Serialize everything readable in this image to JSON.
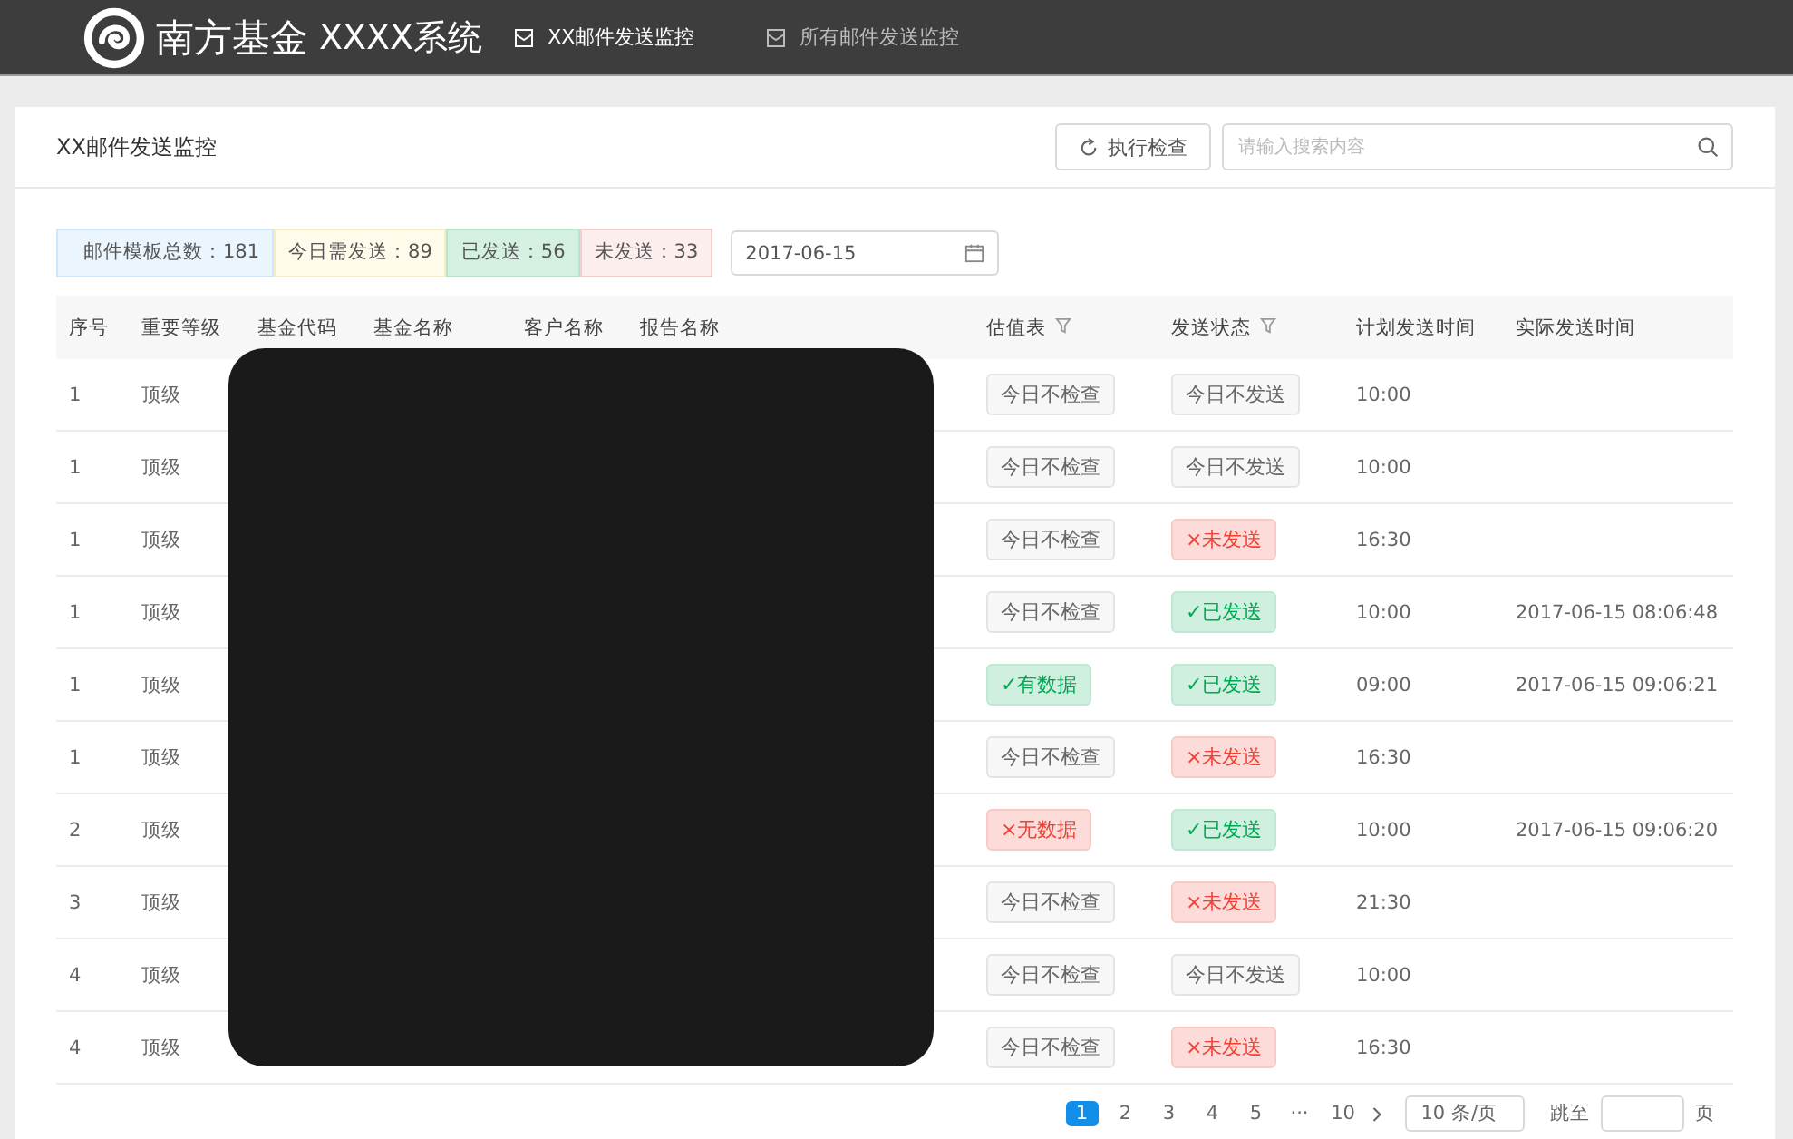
{
  "header": {
    "brand": "南方基金",
    "system": "XXXX系统",
    "nav": [
      {
        "label": "XX邮件发送监控",
        "selected": true
      },
      {
        "label": "所有邮件发送监控",
        "selected": false
      }
    ]
  },
  "card": {
    "title": "XX邮件发送监控",
    "check_button": "执行检查",
    "search": {
      "placeholder": "请输入搜索内容"
    }
  },
  "stats": [
    {
      "label": "邮件模板总数：181",
      "kind": "total"
    },
    {
      "label": "今日需发送：89",
      "kind": "due"
    },
    {
      "label": "已发送：56",
      "kind": "sent"
    },
    {
      "label": "未发送：33",
      "kind": "unsent"
    }
  ],
  "date": "2017-06-15",
  "table": {
    "columns": [
      {
        "label": "序号",
        "filter": false
      },
      {
        "label": "重要等级",
        "filter": false
      },
      {
        "label": "基金代码",
        "filter": false
      },
      {
        "label": "基金名称",
        "filter": false
      },
      {
        "label": "客户名称",
        "filter": false
      },
      {
        "label": "报告名称",
        "filter": false
      },
      {
        "label": "估值表",
        "filter": true
      },
      {
        "label": "发送状态",
        "filter": true
      },
      {
        "label": "计划发送时间",
        "filter": false
      },
      {
        "label": "实际发送时间",
        "filter": false
      }
    ],
    "rows": [
      {
        "no": "1",
        "level": "顶级",
        "valuation": {
          "text": "今日不检查",
          "kind": "neutral"
        },
        "status": {
          "text": "今日不发送",
          "kind": "neutral"
        },
        "planned": "10:00",
        "actual": ""
      },
      {
        "no": "1",
        "level": "顶级",
        "valuation": {
          "text": "今日不检查",
          "kind": "neutral"
        },
        "status": {
          "text": "今日不发送",
          "kind": "neutral"
        },
        "planned": "10:00",
        "actual": ""
      },
      {
        "no": "1",
        "level": "顶级",
        "valuation": {
          "text": "今日不检查",
          "kind": "neutral"
        },
        "status": {
          "text": "×未发送",
          "kind": "bad"
        },
        "planned": "16:30",
        "actual": ""
      },
      {
        "no": "1",
        "level": "顶级",
        "valuation": {
          "text": "今日不检查",
          "kind": "neutral"
        },
        "status": {
          "text": "✓已发送",
          "kind": "good"
        },
        "planned": "10:00",
        "actual": "2017-06-15 08:06:48"
      },
      {
        "no": "1",
        "level": "顶级",
        "valuation": {
          "text": "✓有数据",
          "kind": "good"
        },
        "status": {
          "text": "✓已发送",
          "kind": "good"
        },
        "planned": "09:00",
        "actual": "2017-06-15 09:06:21"
      },
      {
        "no": "1",
        "level": "顶级",
        "valuation": {
          "text": "今日不检查",
          "kind": "neutral"
        },
        "status": {
          "text": "×未发送",
          "kind": "bad"
        },
        "planned": "16:30",
        "actual": ""
      },
      {
        "no": "2",
        "level": "顶级",
        "valuation": {
          "text": "×无数据",
          "kind": "bad"
        },
        "status": {
          "text": "✓已发送",
          "kind": "good"
        },
        "planned": "10:00",
        "actual": "2017-06-15 09:06:20"
      },
      {
        "no": "3",
        "level": "顶级",
        "valuation": {
          "text": "今日不检查",
          "kind": "neutral"
        },
        "status": {
          "text": "×未发送",
          "kind": "bad"
        },
        "planned": "21:30",
        "actual": ""
      },
      {
        "no": "4",
        "level": "顶级",
        "valuation": {
          "text": "今日不检查",
          "kind": "neutral"
        },
        "status": {
          "text": "今日不发送",
          "kind": "neutral"
        },
        "planned": "10:00",
        "actual": ""
      },
      {
        "no": "4",
        "level": "顶级",
        "valuation": {
          "text": "今日不检查",
          "kind": "neutral"
        },
        "status": {
          "text": "×未发送",
          "kind": "bad"
        },
        "planned": "16:30",
        "actual": ""
      }
    ]
  },
  "pagination": {
    "pages": [
      {
        "label": "1",
        "selected": true
      },
      {
        "label": "2",
        "selected": false
      },
      {
        "label": "3",
        "selected": false
      },
      {
        "label": "4",
        "selected": false
      },
      {
        "label": "5",
        "selected": false
      },
      {
        "label": "···",
        "selected": false
      },
      {
        "label": "10",
        "selected": false
      }
    ],
    "page_size": "10 条/页",
    "jump_label": "跳至",
    "jump_suffix": "页"
  }
}
